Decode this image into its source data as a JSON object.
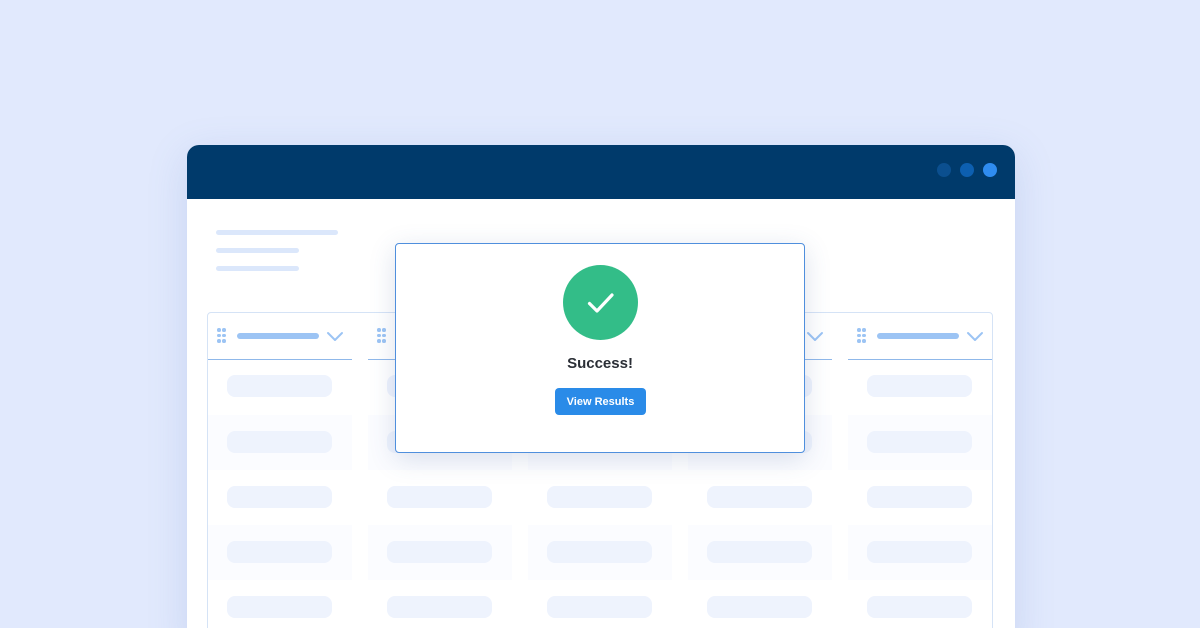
{
  "colors": {
    "page_background": "#e1e9fd",
    "titlebar": "#003a6b",
    "window_dots": [
      "#0b4f8f",
      "#0d5fb0",
      "#2f8cf0"
    ],
    "success": "#33bd88",
    "accent": "#2a8be8",
    "modal_border": "#4f8fdd",
    "column_header_line": "#8fb8ea"
  },
  "window": {
    "controls": [
      "dot-icon",
      "dot-icon",
      "dot-icon"
    ]
  },
  "table": {
    "column_count": 5,
    "row_count": 5,
    "column_header_icons": [
      "drag-handle-icon",
      "chevron-down-icon"
    ]
  },
  "modal": {
    "icon": "checkmark-icon",
    "title": "Success!",
    "button_label": "View Results"
  }
}
